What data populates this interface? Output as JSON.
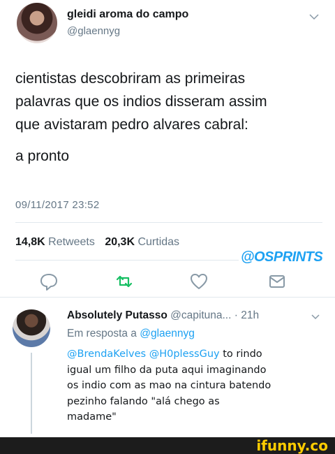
{
  "tweet": {
    "user_name": "gleidi aroma do campo",
    "user_handle": "@glaennyg",
    "text_lines": [
      "cientistas descobriram as primeiras",
      "palavras que os indios disseram assim",
      "que avistaram pedro alvares cabral:",
      "a pronto"
    ],
    "timestamp": "09/11/2017 23:52",
    "retweets_count": "14,8K",
    "retweets_label": "Retweets",
    "likes_count": "20,3K",
    "likes_label": "Curtidas"
  },
  "watermark": "@OSPRINTS",
  "reply": {
    "user_name": "Absolutely Putasso",
    "user_handle": "@capituna...",
    "time": "· 21h",
    "in_reply_prefix": "Em resposta a",
    "in_reply_user": "@glaennyg",
    "mention_1": "@BrendaKelves",
    "mention_2": "@H0plessGuy",
    "first_line_rest": " to rindo",
    "text_lines": [
      "igual um filho da puta aqui imaginando",
      "os indio com as mao na cintura batendo",
      "pezinho falando \"alá chego as",
      "madame\""
    ]
  },
  "footer": {
    "brand": "ifunny.co"
  },
  "colors": {
    "accent": "#1da1f2",
    "retweet_green": "#17bf63",
    "muted_text": "#657786",
    "divider": "#e1e8ed",
    "footer_bg": "#1c1c1c",
    "brand_yellow": "#ffcc00"
  },
  "icons": [
    "chevron-down-icon",
    "reply-icon",
    "retweet-icon",
    "like-icon",
    "message-icon"
  ]
}
